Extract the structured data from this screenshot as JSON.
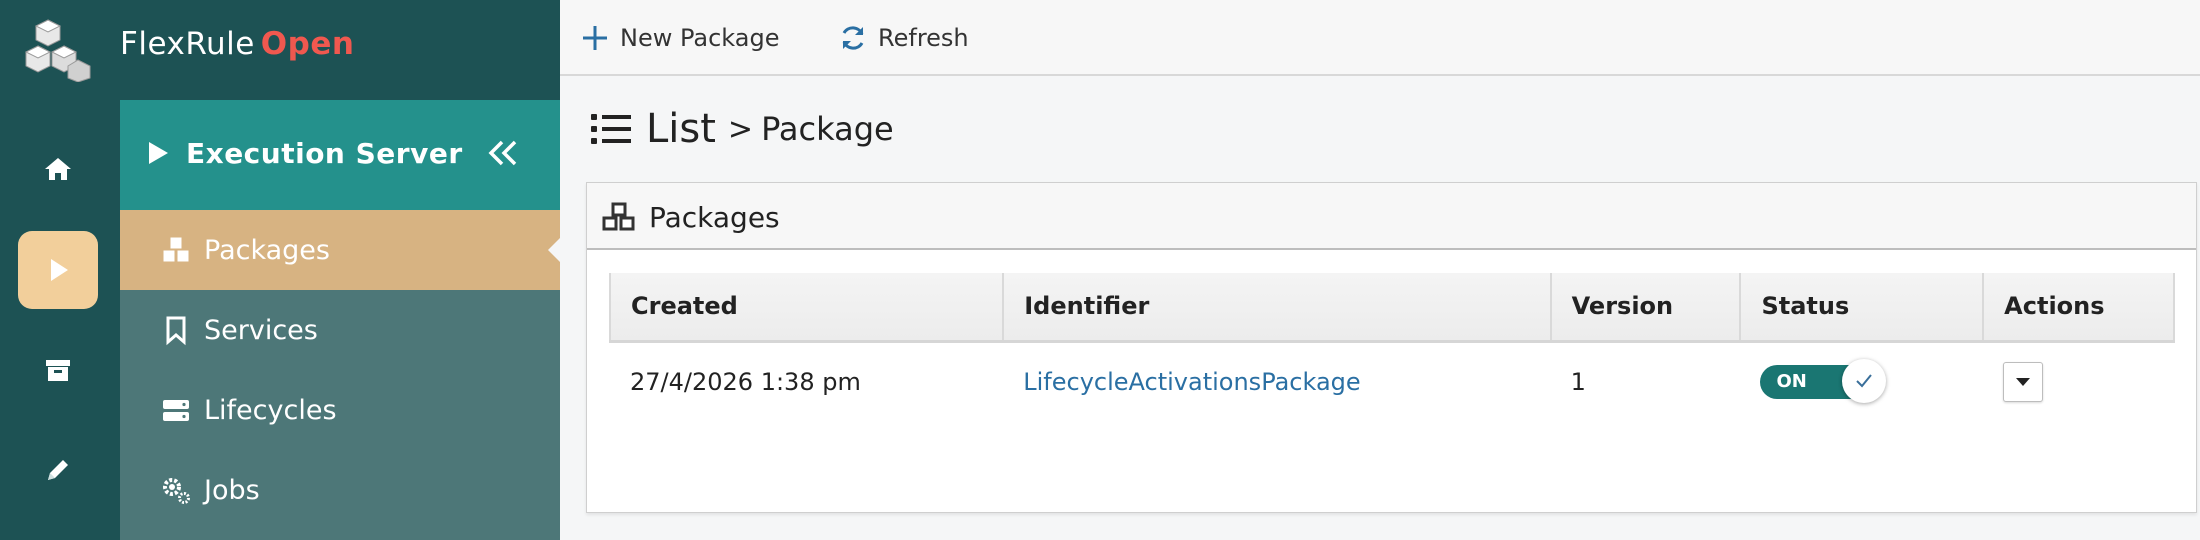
{
  "brand": {
    "name": "FlexRule",
    "accent": "Open",
    "accent_color": "#f0584f"
  },
  "rail": {
    "items": [
      {
        "icon": "home-icon",
        "active": false
      },
      {
        "icon": "play-icon",
        "active": true
      },
      {
        "icon": "archive-icon",
        "active": false
      },
      {
        "icon": "pencil-icon",
        "active": false
      }
    ]
  },
  "subnav": {
    "title": "Execution Server",
    "items": [
      {
        "label": "Packages",
        "icon": "cubes-icon",
        "active": true
      },
      {
        "label": "Services",
        "icon": "bookmark-icon",
        "active": false
      },
      {
        "label": "Lifecycles",
        "icon": "server-icon",
        "active": false
      },
      {
        "label": "Jobs",
        "icon": "cogs-icon",
        "active": false
      }
    ]
  },
  "toolbar": {
    "new_label": "New Package",
    "refresh_label": "Refresh"
  },
  "breadcrumb": {
    "list": "List",
    "sep": ">",
    "current": "Package"
  },
  "panel": {
    "title": "Packages",
    "columns": [
      "Created",
      "Identifier",
      "Version",
      "Status",
      "Actions"
    ],
    "rows": [
      {
        "created": "27/4/2026 1:38 pm",
        "identifier": "LifecycleActivationsPackage",
        "version": "1",
        "status": "ON"
      }
    ]
  },
  "colors": {
    "rail": "#1d5254",
    "subnav_header": "#24918c",
    "subnav": "#4d7778",
    "active_item": "#d7b382",
    "toggle": "#1a7672",
    "link": "#2a6fa3"
  }
}
